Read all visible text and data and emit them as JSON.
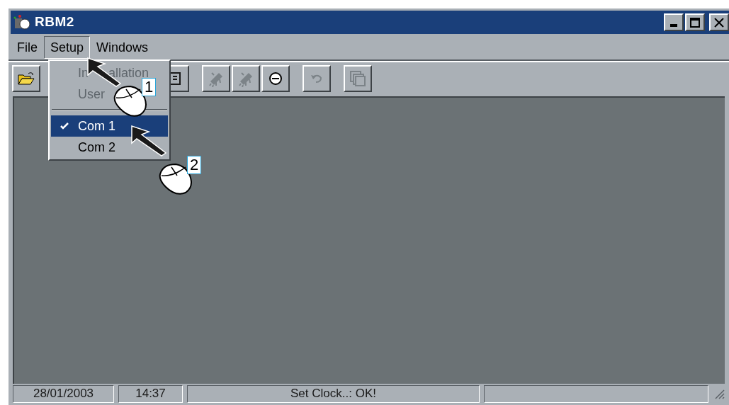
{
  "window": {
    "title": "RBM2"
  },
  "menu_bar": [
    {
      "label": "File",
      "selected": false
    },
    {
      "label": "Setup",
      "selected": true
    },
    {
      "label": "Windows",
      "selected": false
    }
  ],
  "dropdown": {
    "items": [
      {
        "kind": "item",
        "label": "In",
        "label_after_cursor": "allation",
        "disabled": true,
        "checked": false,
        "selected": false
      },
      {
        "kind": "item",
        "label": "User",
        "disabled": true,
        "checked": false,
        "selected": false
      },
      {
        "kind": "separator"
      },
      {
        "kind": "item",
        "label": "Com 1",
        "disabled": false,
        "checked": true,
        "selected": true
      },
      {
        "kind": "item",
        "label": "Com 2",
        "disabled": false,
        "checked": false,
        "selected": false
      }
    ]
  },
  "toolbar": [
    {
      "kind": "open"
    },
    {
      "kind": "gap"
    },
    {
      "kind": "doc",
      "disabled": false
    },
    {
      "kind": "chip",
      "disabled": true
    },
    {
      "kind": "chip",
      "disabled": true
    },
    {
      "kind": "gauge"
    },
    {
      "kind": "undo",
      "disabled": true
    },
    {
      "kind": "windows",
      "disabled": true
    }
  ],
  "callouts": [
    {
      "label": "1"
    },
    {
      "label": "2"
    }
  ],
  "status_bar": [
    "28/01/2003",
    "14:37",
    "Set Clock..: OK!"
  ]
}
